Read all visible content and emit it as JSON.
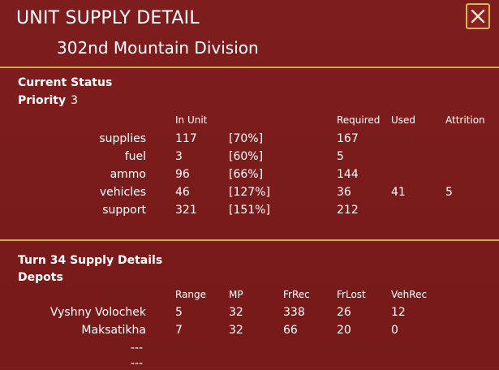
{
  "window": {
    "title": "UNIT SUPPLY DETAIL",
    "unit_name": "302nd Mountain Division",
    "close_icon": "close-icon"
  },
  "current_status": {
    "heading": "Current Status",
    "priority_label": "Priority",
    "priority_value": "3",
    "columns": {
      "in_unit": "In Unit",
      "required": "Required",
      "used": "Used",
      "attrition": "Attrition"
    },
    "rows": [
      {
        "label": "supplies",
        "in_unit": "117",
        "pct": "[70%]",
        "required": "167",
        "used": "",
        "attrition": ""
      },
      {
        "label": "fuel",
        "in_unit": "3",
        "pct": "[60%]",
        "required": "5",
        "used": "",
        "attrition": ""
      },
      {
        "label": "ammo",
        "in_unit": "96",
        "pct": "[66%]",
        "required": "144",
        "used": "",
        "attrition": ""
      },
      {
        "label": "vehicles",
        "in_unit": "46",
        "pct": "[127%]",
        "required": "36",
        "used": "41",
        "attrition": "5"
      },
      {
        "label": "support",
        "in_unit": "321",
        "pct": "[151%]",
        "required": "212",
        "used": "",
        "attrition": ""
      }
    ]
  },
  "supply_details": {
    "heading": "Turn 34 Supply Details",
    "depots_label": "Depots",
    "columns": {
      "range": "Range",
      "mp": "MP",
      "frrec": "FrRec",
      "frlost": "FrLost",
      "vehrec": "VehRec"
    },
    "depots": [
      {
        "name": "Vyshny Volochek",
        "range": "5",
        "mp": "32",
        "frrec": "338",
        "frlost": "26",
        "vehrec": "12"
      },
      {
        "name": "Maksatikha",
        "range": "7",
        "mp": "32",
        "frrec": "66",
        "frlost": "20",
        "vehrec": "0"
      },
      {
        "name": "---"
      },
      {
        "name": "---"
      }
    ]
  },
  "colors": {
    "background": "#7b1c1c",
    "divider": "#d3aa4f",
    "text": "#ffffff"
  }
}
